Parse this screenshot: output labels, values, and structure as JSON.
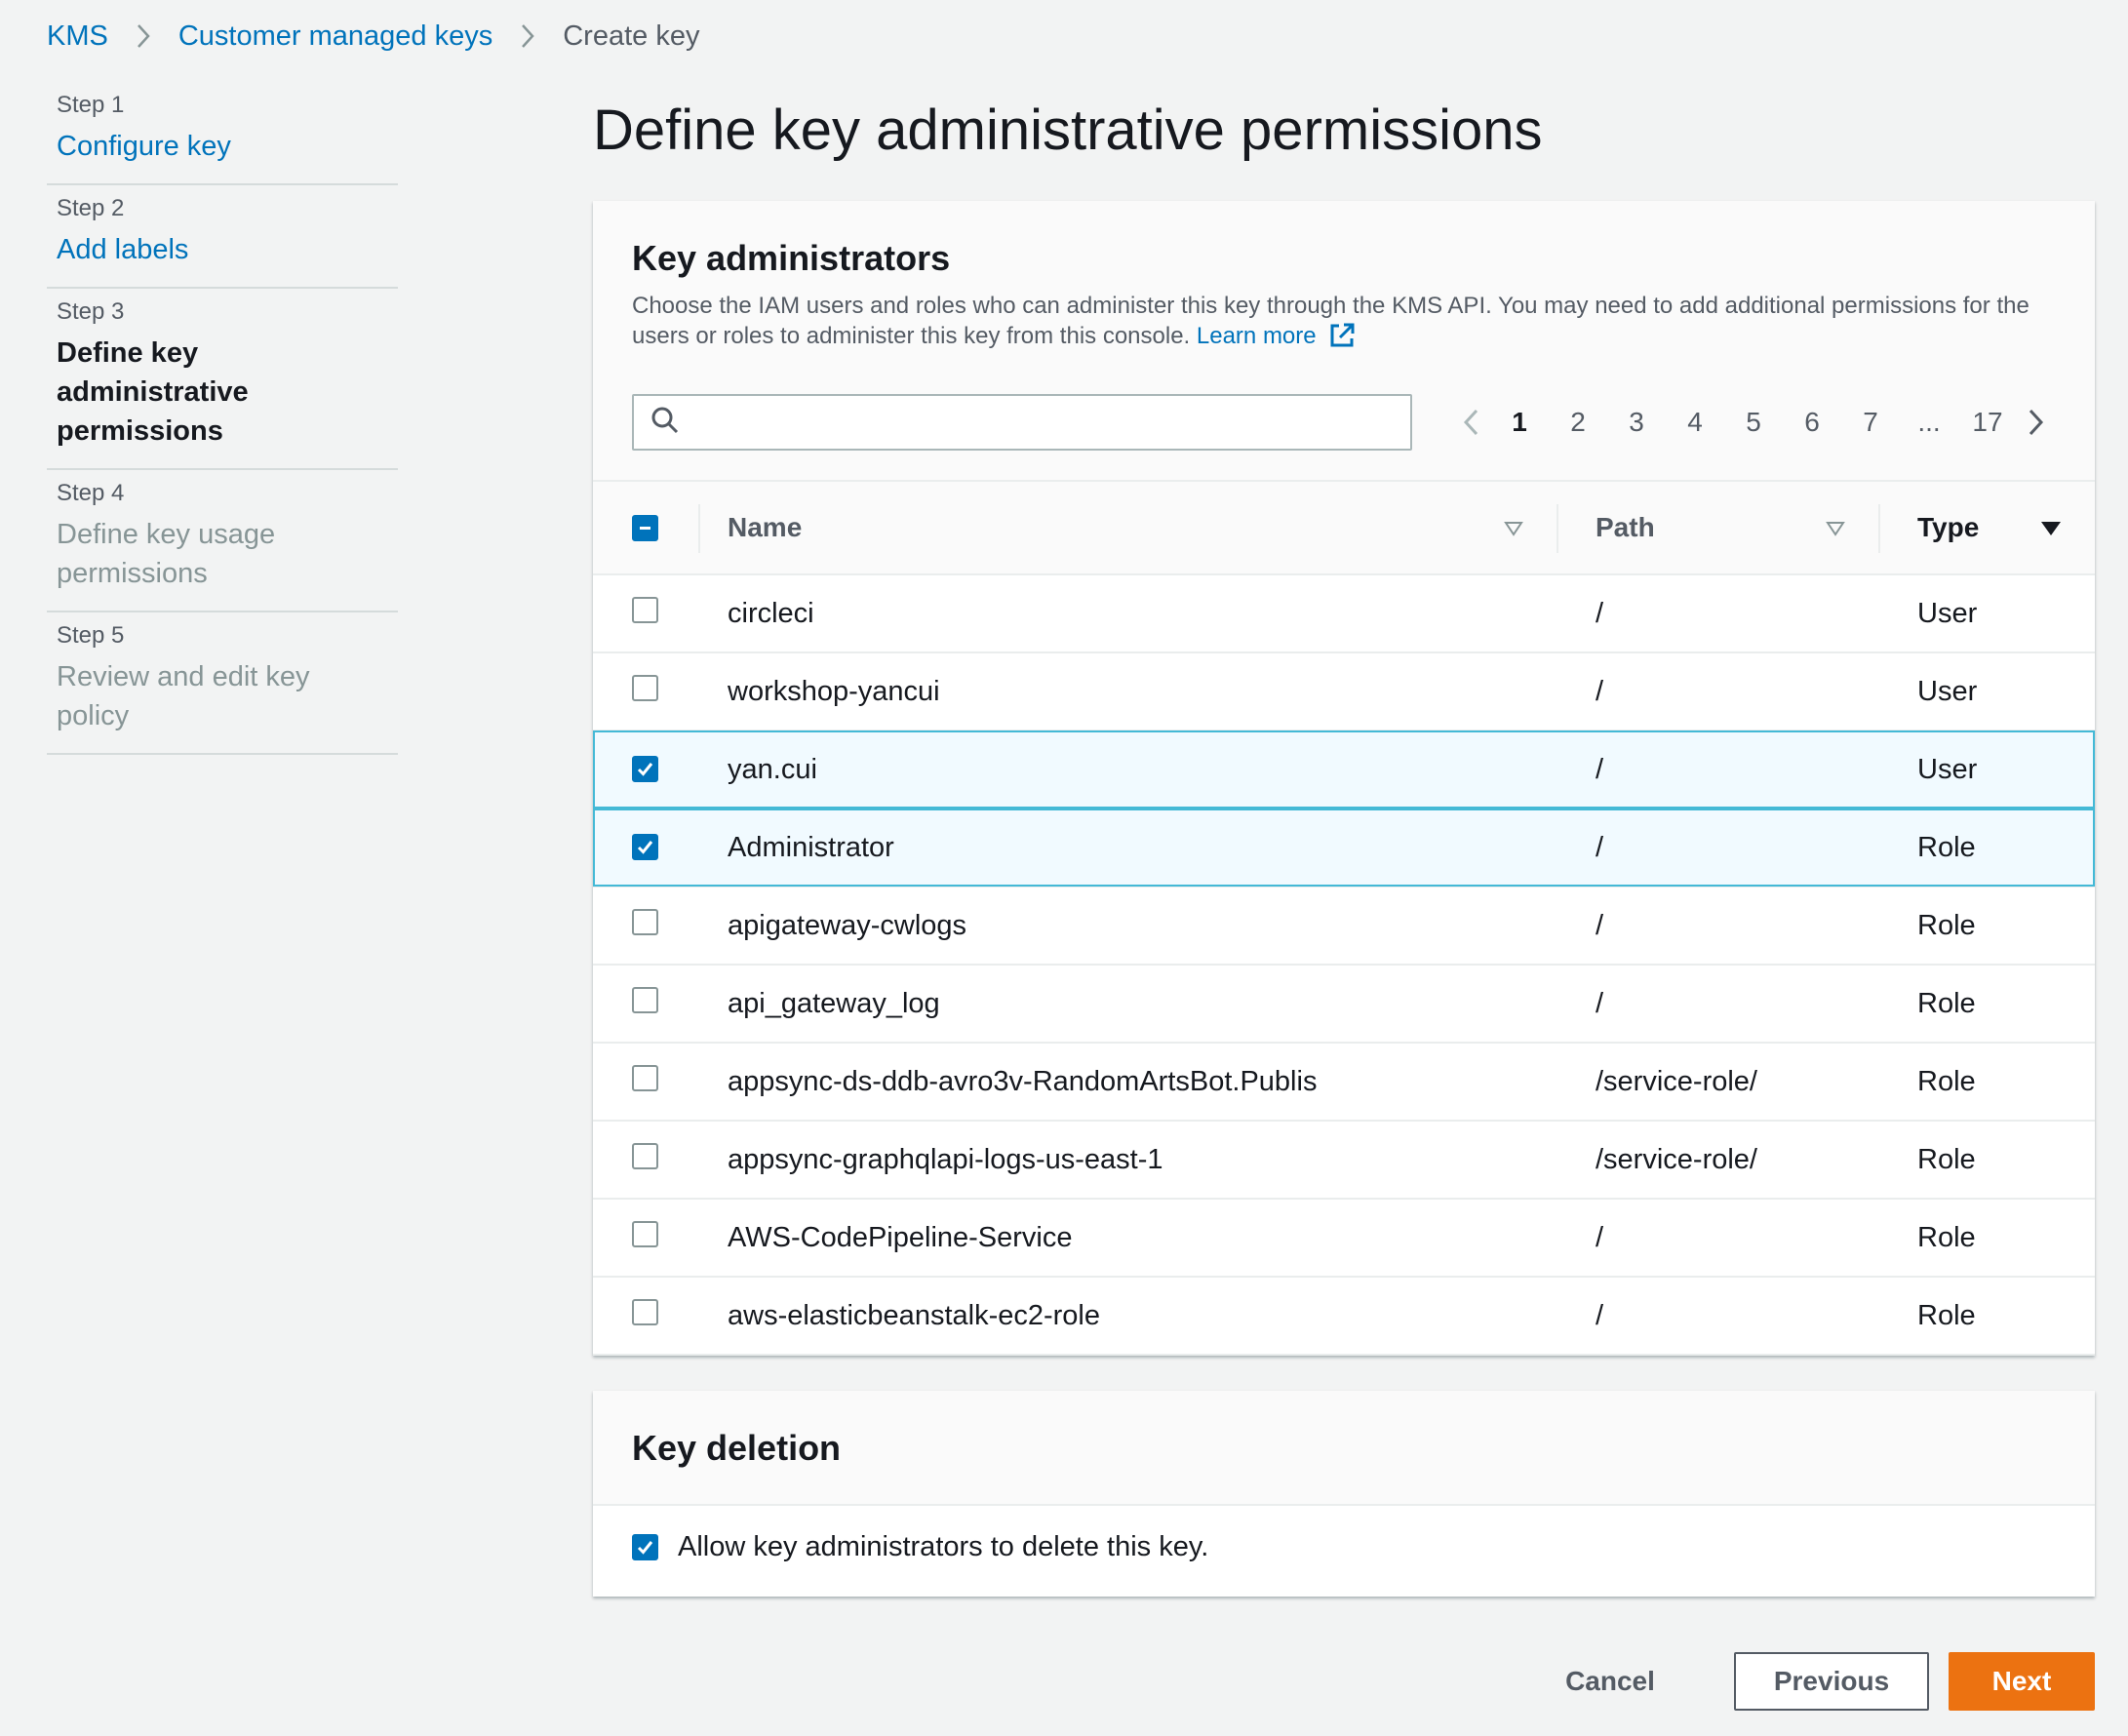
{
  "breadcrumb": {
    "items": [
      {
        "label": "KMS"
      },
      {
        "label": "Customer managed keys"
      },
      {
        "label": "Create key"
      }
    ]
  },
  "steps": [
    {
      "number": "Step 1",
      "title": "Configure key",
      "state": "link"
    },
    {
      "number": "Step 2",
      "title": "Add labels",
      "state": "link"
    },
    {
      "number": "Step 3",
      "title": "Define key administrative permissions",
      "state": "current"
    },
    {
      "number": "Step 4",
      "title": "Define key usage permissions",
      "state": "disabled"
    },
    {
      "number": "Step 5",
      "title": "Review and edit key policy",
      "state": "disabled"
    }
  ],
  "page": {
    "title": "Define key administrative permissions"
  },
  "key_admins": {
    "title": "Key administrators",
    "description": "Choose the IAM users and roles who can administer this key through the KMS API. You may need to add additional permissions for the users or roles to administer this key from this console.",
    "learn_more": "Learn more",
    "search": {
      "value": "",
      "placeholder": ""
    },
    "pagination": {
      "pages": [
        "1",
        "2",
        "3",
        "4",
        "5",
        "6",
        "7",
        "...",
        "17"
      ],
      "current": "1"
    },
    "columns": {
      "name": "Name",
      "path": "Path",
      "type": "Type"
    },
    "rows": [
      {
        "name": "circleci",
        "path": "/",
        "type": "User",
        "checked": false
      },
      {
        "name": "workshop-yancui",
        "path": "/",
        "type": "User",
        "checked": false
      },
      {
        "name": "yan.cui",
        "path": "/",
        "type": "User",
        "checked": true
      },
      {
        "name": "Administrator",
        "path": "/",
        "type": "Role",
        "checked": true
      },
      {
        "name": "apigateway-cwlogs",
        "path": "/",
        "type": "Role",
        "checked": false
      },
      {
        "name": "api_gateway_log",
        "path": "/",
        "type": "Role",
        "checked": false
      },
      {
        "name": "appsync-ds-ddb-avro3v-RandomArtsBot.Publis",
        "path": "/service-role/",
        "type": "Role",
        "checked": false
      },
      {
        "name": "appsync-graphqlapi-logs-us-east-1",
        "path": "/service-role/",
        "type": "Role",
        "checked": false
      },
      {
        "name": "AWS-CodePipeline-Service",
        "path": "/",
        "type": "Role",
        "checked": false
      },
      {
        "name": "aws-elasticbeanstalk-ec2-role",
        "path": "/",
        "type": "Role",
        "checked": false
      }
    ]
  },
  "key_deletion": {
    "title": "Key deletion",
    "allow_label": "Allow key administrators to delete this key.",
    "allow_checked": true
  },
  "footer": {
    "cancel": "Cancel",
    "previous": "Previous",
    "next": "Next"
  },
  "colors": {
    "link": "#0073bb",
    "primary": "#ec7211",
    "selected_row": "#f1faff",
    "selected_border": "#44b9d6"
  }
}
